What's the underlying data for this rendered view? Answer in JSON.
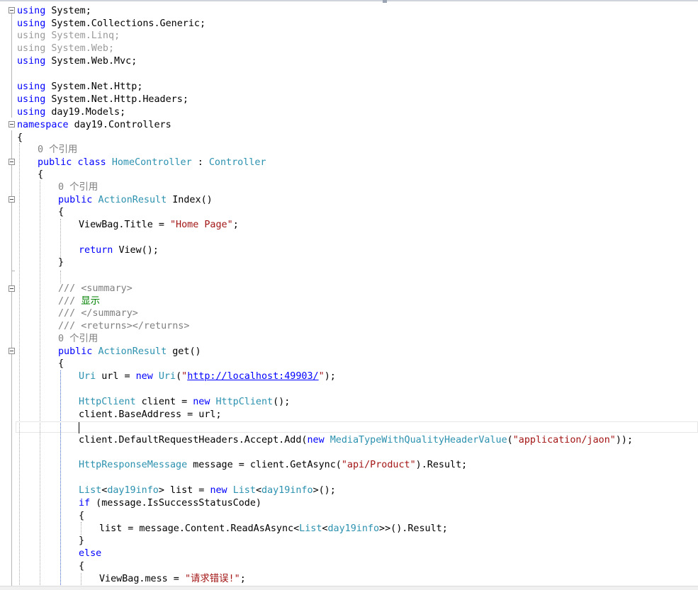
{
  "editor": {
    "code": {
      "l1": "System",
      "l2": "System.Collections.Generic",
      "l3": "System.Linq",
      "l4": "System.Web",
      "l5": "System.Web.Mvc",
      "l6": "System.Net.Http",
      "l7": "System.Net.Http.Headers",
      "l8": "day19.Models",
      "l9": "day19.Controllers",
      "ref_label": "0 个引用",
      "class_name": "HomeController",
      "base_class": "Controller",
      "action_result": "ActionResult",
      "index_method": "Index",
      "viewbag_title": "ViewBag.Title = ",
      "home_page": "\"Home Page\"",
      "return_view": "View();",
      "summary_open": "<summary>",
      "summary_text": "显示",
      "summary_close": "</summary>",
      "returns": "<returns></returns>",
      "get_method": "get",
      "uri_type": "Uri",
      "url_var": " url = ",
      "localhost": "http://localhost:49903/",
      "httpclient_type": "HttpClient",
      "client_var": " client = ",
      "base_address": "client.BaseAddress = url;",
      "accept_add": "client.DefaultRequestHeaders.Accept.Add(",
      "mtwq": "MediaTypeWithQualityHeaderValue",
      "app_json": "\"application/jaon\"",
      "http_response": "HttpResponseMessage",
      "message_get": " message = client.GetAsync(",
      "api_product": "\"api/Product\"",
      "result_tail": ").Result;",
      "list_type": "List",
      "info_type": "day19info",
      "list_var": "> list = ",
      "if_cond": " (message.IsSuccessStatusCode)",
      "read_async": "list = message.Content.ReadAsAsync<",
      "mess": "ViewBag.mess = ",
      "err_str": "\"请求错误!\""
    }
  }
}
